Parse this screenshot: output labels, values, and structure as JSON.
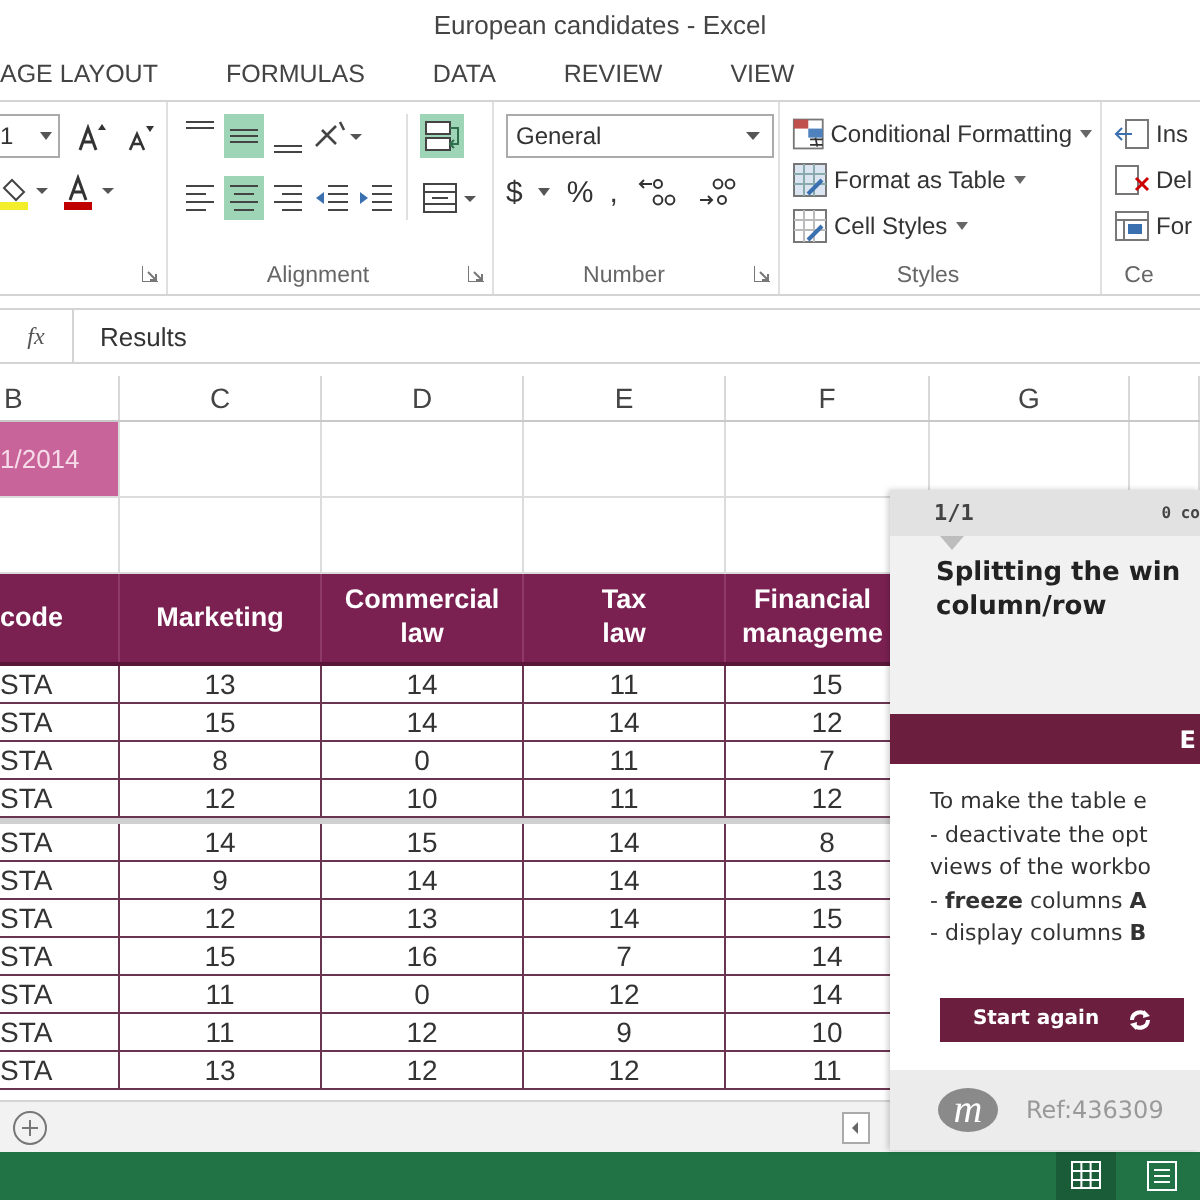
{
  "window": {
    "title": "European candidates - Excel"
  },
  "ribbon_tabs": [
    {
      "label": "AGE LAYOUT"
    },
    {
      "label": "FORMULAS"
    },
    {
      "label": "DATA"
    },
    {
      "label": "REVIEW"
    },
    {
      "label": "VIEW"
    }
  ],
  "ribbon": {
    "font_size": "1",
    "alignment_buttons": [
      {
        "kind": "top",
        "on": false
      },
      {
        "kind": "middle",
        "on": true
      },
      {
        "kind": "bottom",
        "on": false
      },
      {
        "kind": "orientation",
        "on": false
      },
      {
        "kind": "left",
        "on": false
      },
      {
        "kind": "center",
        "on": true
      },
      {
        "kind": "right",
        "on": false
      },
      {
        "kind": "outdent",
        "on": false
      },
      {
        "kind": "indent",
        "on": false
      }
    ],
    "wrap_text": {
      "on": true
    },
    "alignment_label": "Alignment",
    "number_format": "General",
    "number_buttons": [
      "$",
      "%",
      ","
    ],
    "number_label": "Number",
    "styles": [
      "Conditional Formatting",
      "Format as Table",
      "Cell Styles"
    ],
    "styles_label": "Styles",
    "cells": [
      "Ins",
      "Del",
      "For"
    ],
    "cells_label": "Ce"
  },
  "formula_bar": {
    "fx": "fx",
    "value": "Results"
  },
  "columns": [
    "B",
    "C",
    "D",
    "E",
    "F",
    "G"
  ],
  "date_cell": "1/2014",
  "table": {
    "headers": [
      "code",
      "Marketing",
      "Commercial law",
      "Tax law",
      "Financial manageme"
    ],
    "rows": [
      {
        "cells": [
          "STA",
          "13",
          "14",
          "11",
          "15"
        ],
        "split_below": false
      },
      {
        "cells": [
          "STA",
          "15",
          "14",
          "14",
          "12"
        ],
        "split_below": false
      },
      {
        "cells": [
          "STA",
          "8",
          "0",
          "11",
          "7"
        ],
        "split_below": false
      },
      {
        "cells": [
          "STA",
          "12",
          "10",
          "11",
          "12"
        ],
        "split_below": true
      },
      {
        "cells": [
          "STA",
          "14",
          "15",
          "14",
          "8"
        ],
        "split_below": false
      },
      {
        "cells": [
          "STA",
          "9",
          "14",
          "14",
          "13"
        ],
        "split_below": false
      },
      {
        "cells": [
          "STA",
          "12",
          "13",
          "14",
          "15"
        ],
        "split_below": false
      },
      {
        "cells": [
          "STA",
          "15",
          "16",
          "7",
          "14"
        ],
        "split_below": false
      },
      {
        "cells": [
          "STA",
          "11",
          "0",
          "12",
          "14"
        ],
        "split_below": false
      },
      {
        "cells": [
          "STA",
          "11",
          "12",
          "9",
          "10"
        ],
        "split_below": false
      },
      {
        "cells": [
          "STA",
          "13",
          "12",
          "12",
          "11"
        ],
        "split_below": false
      }
    ]
  },
  "panel": {
    "step": "1/1",
    "counter": "0 co",
    "title_lines": [
      "Splitting the win",
      "column/row"
    ],
    "section": "E",
    "text_lines": [
      "To make the table e",
      "- deactivate the opt",
      "views of the workbo",
      "- **freeze** columns **A**",
      "- display columns **B**"
    ],
    "button": "Start again",
    "logo": "m",
    "ref": "Ref:436309"
  }
}
